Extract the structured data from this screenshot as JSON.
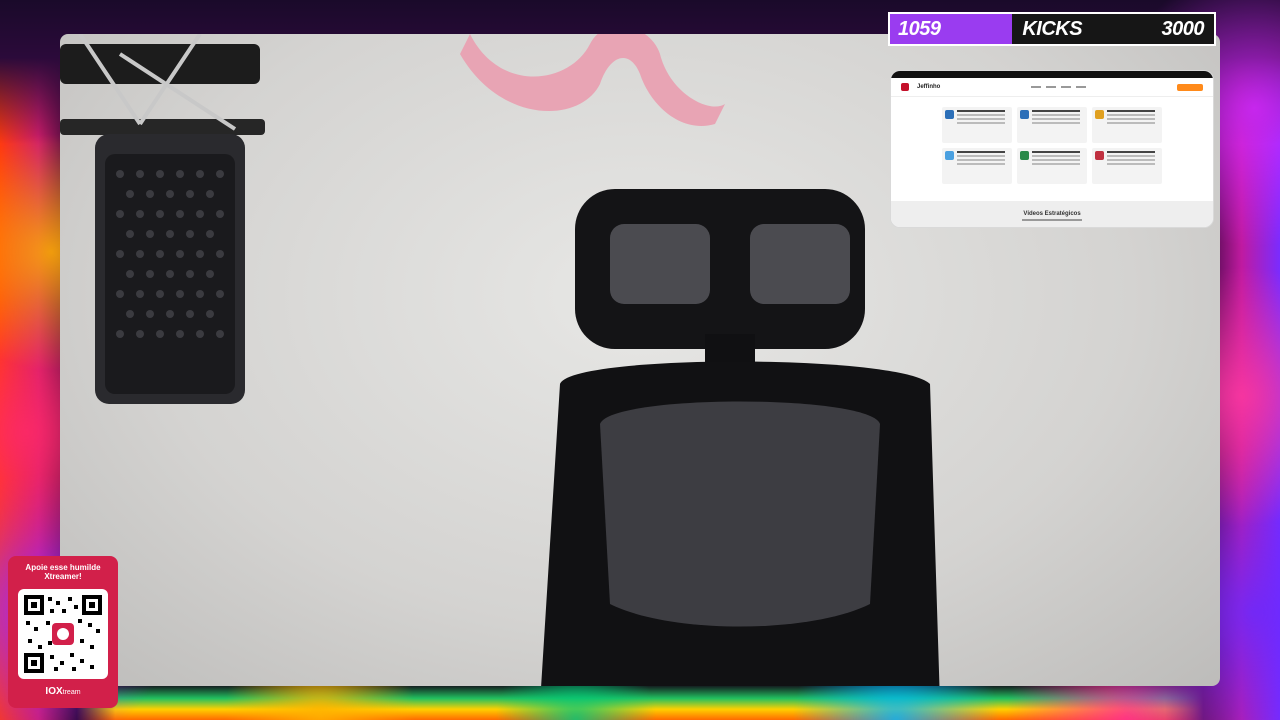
{
  "goal_bar": {
    "current": "1059",
    "label": "KICKS",
    "target": "3000",
    "progress": 0.353,
    "fill_color": "#9a3cf0"
  },
  "website_preview": {
    "logo_text": "Jeffinho",
    "footer_title": "Vídeos Estratégicos"
  },
  "support_panel": {
    "title_line1": "Apoie esse humilde",
    "title_line2": "Xtreamer!",
    "brand_bold": "IOX",
    "brand_rest": "tream",
    "qr_icon": "qr-code-icon"
  },
  "colors": {
    "support_panel": "#d2204a",
    "goal_fill": "#9a3cf0"
  }
}
